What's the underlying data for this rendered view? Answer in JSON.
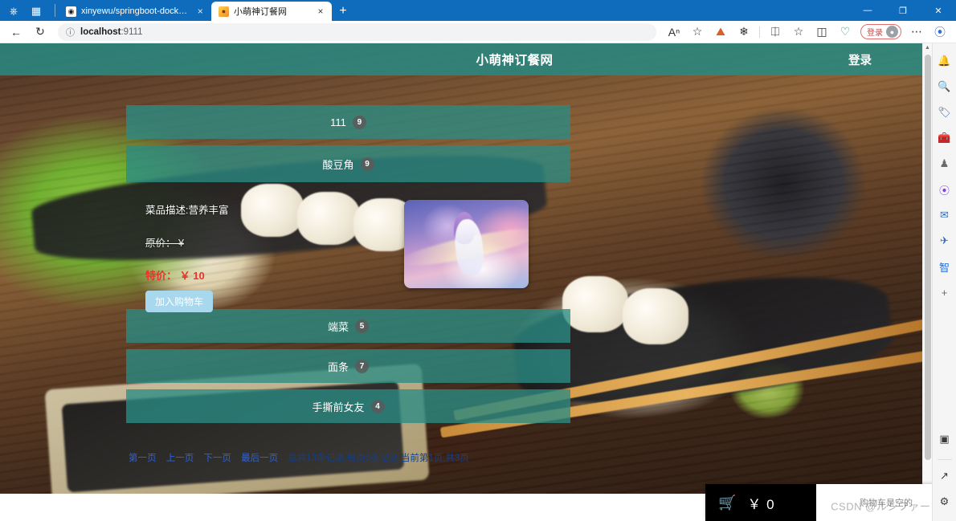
{
  "browser": {
    "titlebar_icons": [
      "copilot-icon",
      "tab-actions-icon"
    ],
    "tabs": [
      {
        "title": "xinyewu/springboot-docker--",
        "favicon": "github-icon",
        "active": false,
        "close": "×"
      },
      {
        "title": "小萌神订餐网",
        "favicon": "site-icon",
        "active": true,
        "close": "×"
      }
    ],
    "new_tab_label": "+",
    "window_controls": {
      "minimize": "—",
      "maximize": "❐",
      "close": "✕"
    },
    "nav": {
      "back": "←",
      "refresh": "↻"
    },
    "omnibox": {
      "info_icon": "info-circle-icon",
      "url_host": "localhost",
      "url_port": ":9111"
    },
    "toolbar_icons": [
      "read-aloud-icon",
      "favorite-star-icon",
      "collections-icon",
      "browser-essentials-icon",
      "split-screen-icon",
      "favorites-icon",
      "tab-collections-icon",
      "shopping-icon"
    ],
    "profile": {
      "label": "登录",
      "avatar": "avatar-icon"
    },
    "more_label": "⋯",
    "copilot_label": "copilot-icon"
  },
  "edge_sidebar": {
    "items": [
      {
        "icon": "bell-icon"
      },
      {
        "icon": "search-icon"
      },
      {
        "icon": "tag-icon"
      },
      {
        "icon": "toolbox-icon"
      },
      {
        "icon": "chess-icon"
      },
      {
        "icon": "copilot-circle-icon"
      },
      {
        "icon": "outlook-icon"
      },
      {
        "icon": "paper-plane-icon"
      },
      {
        "icon": "zhi-icon",
        "glyph": "智"
      },
      {
        "icon": "add-icon",
        "glyph": "+"
      }
    ],
    "bottom_items": [
      {
        "icon": "screenshot-icon"
      },
      {
        "icon": "open-external-icon"
      },
      {
        "icon": "settings-gear-icon"
      }
    ]
  },
  "page": {
    "header": {
      "title": "小萌神订餐网",
      "login_label": "登录"
    },
    "accordion": [
      {
        "name": "111",
        "count": "9",
        "expanded": false
      },
      {
        "name": "酸豆角",
        "count": "9",
        "expanded": true
      },
      {
        "name": "端菜",
        "count": "5",
        "expanded": false
      },
      {
        "name": "面条",
        "count": "7",
        "expanded": false
      },
      {
        "name": "手撕前女友",
        "count": "4",
        "expanded": false
      }
    ],
    "dish": {
      "description": "菜品描述:营养丰富",
      "original_price": "原价： ¥",
      "special_price": "特价： ￥ 10",
      "add_to_cart": "加入购物车",
      "thumb_alt": "dish-thumbnail"
    },
    "pagination": {
      "first": "第一页",
      "prev": "上一页",
      "next": "下一页",
      "last": "最后一页",
      "meta": "总共13条记录,每页5条记录,当前第1页,共3页"
    },
    "cart": {
      "icon": "shopping-cart-icon",
      "total": "￥ 0",
      "empty_text": "购物车是空的"
    },
    "watermark": "CSDN @ルシファード"
  },
  "colors": {
    "brand_teal": "#2a8880",
    "accent_red": "#e8342c",
    "cart_bg": "#000000",
    "cart_icon": "#f3a53a",
    "link_blue": "#2b63d9",
    "button_blue": "#a8d8ee"
  }
}
